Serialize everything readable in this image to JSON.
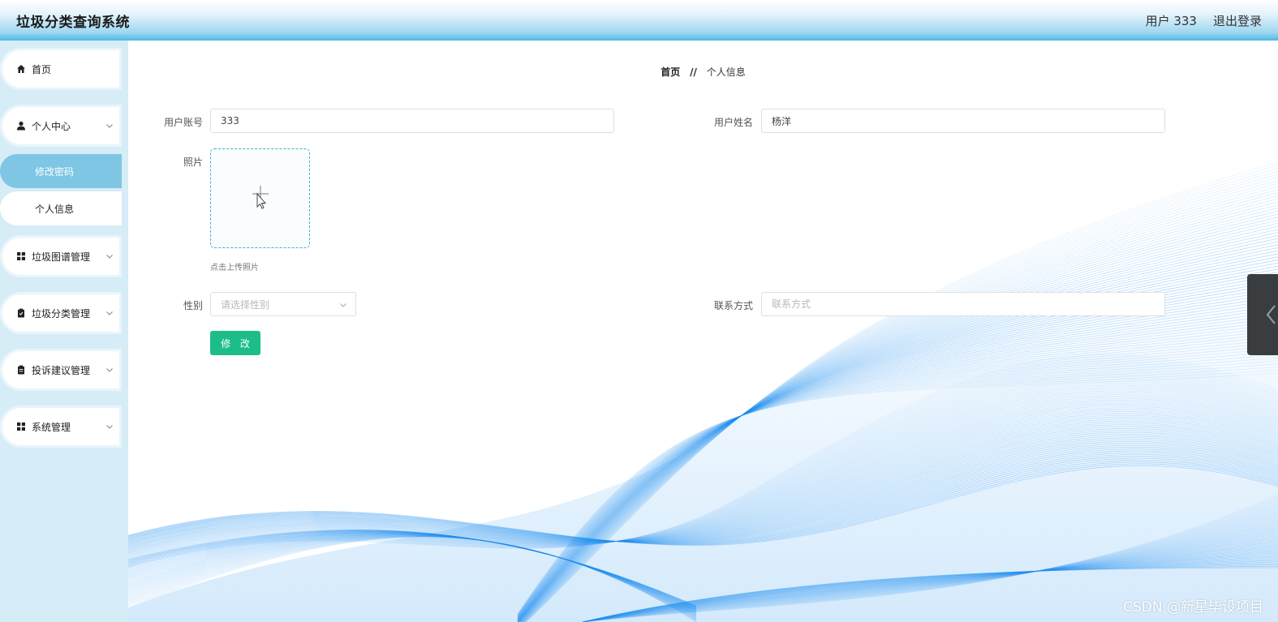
{
  "header": {
    "app_title": "垃圾分类查询系统",
    "user_label": "用户 333",
    "logout_label": "退出登录"
  },
  "sidebar": {
    "items": [
      {
        "label": "首页",
        "icon": "home-icon"
      },
      {
        "label": "个人中心",
        "icon": "user-icon",
        "sub": [
          {
            "label": "修改密码",
            "active": true
          },
          {
            "label": "个人信息",
            "active": false
          }
        ]
      },
      {
        "label": "垃圾图谱管理",
        "icon": "grid-icon"
      },
      {
        "label": "垃圾分类管理",
        "icon": "clipboard-icon"
      },
      {
        "label": "投诉建议管理",
        "icon": "clipboard-icon"
      },
      {
        "label": "系统管理",
        "icon": "grid-icon"
      }
    ]
  },
  "breadcrumb": {
    "home": "首页",
    "separator": "//",
    "current": "个人信息"
  },
  "form": {
    "account_label": "用户账号",
    "account_value": "333",
    "name_label": "用户姓名",
    "name_value": "杨洋",
    "photo_label": "照片",
    "upload_tip": "点击上传照片",
    "gender_label": "性别",
    "gender_placeholder": "请选择性别",
    "contact_label": "联系方式",
    "contact_placeholder": "联系方式",
    "submit_label": "修 改"
  },
  "watermark": "CSDN @新星毕设项目",
  "colors": {
    "accent": "#1dbd8b",
    "active_menu": "#7ec6e4",
    "sidebar_bg": "#d6ecf6",
    "wave": "#1e8ff0"
  }
}
